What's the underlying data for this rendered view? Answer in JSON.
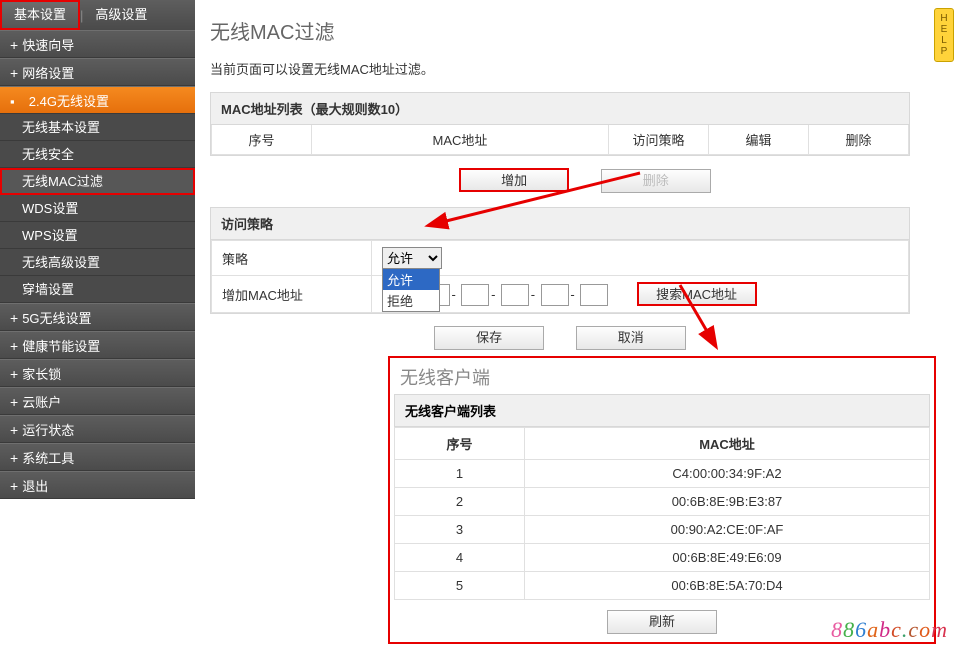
{
  "top_tabs": {
    "basic": "基本设置",
    "advanced": "高级设置"
  },
  "sidebar": {
    "groups": [
      {
        "label": "快速向导"
      },
      {
        "label": "网络设置"
      },
      {
        "label": "2.4G无线设置",
        "active": true,
        "subs": [
          {
            "label": "无线基本设置"
          },
          {
            "label": "无线安全"
          },
          {
            "label": "无线MAC过滤",
            "selected": true
          },
          {
            "label": "WDS设置"
          },
          {
            "label": "WPS设置"
          },
          {
            "label": "无线高级设置"
          },
          {
            "label": "穿墙设置"
          }
        ]
      },
      {
        "label": "5G无线设置"
      },
      {
        "label": "健康节能设置"
      },
      {
        "label": "家长锁"
      },
      {
        "label": "云账户"
      },
      {
        "label": "运行状态"
      },
      {
        "label": "系统工具"
      },
      {
        "label": "退出"
      }
    ]
  },
  "page": {
    "title": "无线MAC过滤",
    "desc": "当前页面可以设置无线MAC地址过滤。"
  },
  "mac_list": {
    "header": "MAC地址列表（最大规则数10）",
    "cols": {
      "seq": "序号",
      "mac": "MAC地址",
      "policy": "访问策略",
      "edit": "编辑",
      "del": "删除"
    }
  },
  "buttons": {
    "add": "增加",
    "delete": "删除",
    "save": "保存",
    "cancel": "取消",
    "search_mac": "搜索MAC地址",
    "refresh": "刷新"
  },
  "policy_panel": {
    "header": "访问策略",
    "row_policy": "策略",
    "row_addmac": "增加MAC地址",
    "select_value": "允许",
    "options": {
      "allow": "允许",
      "deny": "拒绝"
    }
  },
  "dialog": {
    "title": "无线客户端",
    "list_header": "无线客户端列表",
    "cols": {
      "seq": "序号",
      "mac": "MAC地址"
    },
    "rows": [
      {
        "seq": "1",
        "mac": "C4:00:00:34:9F:A2"
      },
      {
        "seq": "2",
        "mac": "00:6B:8E:9B:E3:87"
      },
      {
        "seq": "3",
        "mac": "00:90:A2:CE:0F:AF"
      },
      {
        "seq": "4",
        "mac": "00:6B:8E:49:E6:09"
      },
      {
        "seq": "5",
        "mac": "00:6B:8E:5A:70:D4"
      }
    ]
  },
  "help_label": "HELP",
  "watermark": "886abc.com"
}
